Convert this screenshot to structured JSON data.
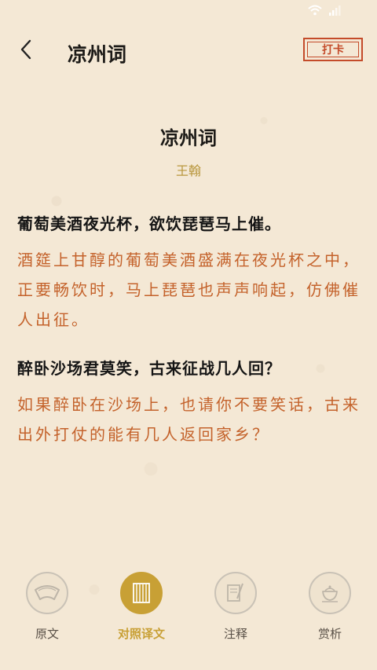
{
  "header": {
    "title": "凉州词",
    "checkin_label": "打卡"
  },
  "poem": {
    "title": "凉州词",
    "author": "王翰",
    "stanzas": [
      {
        "verse": "葡萄美酒夜光杯，欲饮琵琶马上催。",
        "translation": "酒筵上甘醇的葡萄美酒盛满在夜光杯之中，正要畅饮时，马上琵琶也声声响起，仿佛催人出征。"
      },
      {
        "verse": "醉卧沙场君莫笑，古来征战几人回？",
        "translation": "如果醉卧在沙场上，也请你不要笑话，古来出外打仗的能有几人返回家乡？"
      }
    ]
  },
  "nav": {
    "items": [
      {
        "label": "原文",
        "icon": "fan-icon",
        "active": false
      },
      {
        "label": "对照译文",
        "icon": "bamboo-scroll-icon",
        "active": true
      },
      {
        "label": "注释",
        "icon": "brush-paper-icon",
        "active": false
      },
      {
        "label": "赏析",
        "icon": "tea-cup-icon",
        "active": false
      }
    ]
  },
  "colors": {
    "background": "#f4e8d5",
    "accent_gold": "#c8a035",
    "translation_orange": "#c4622b",
    "stamp_red": "#c44b2a"
  }
}
